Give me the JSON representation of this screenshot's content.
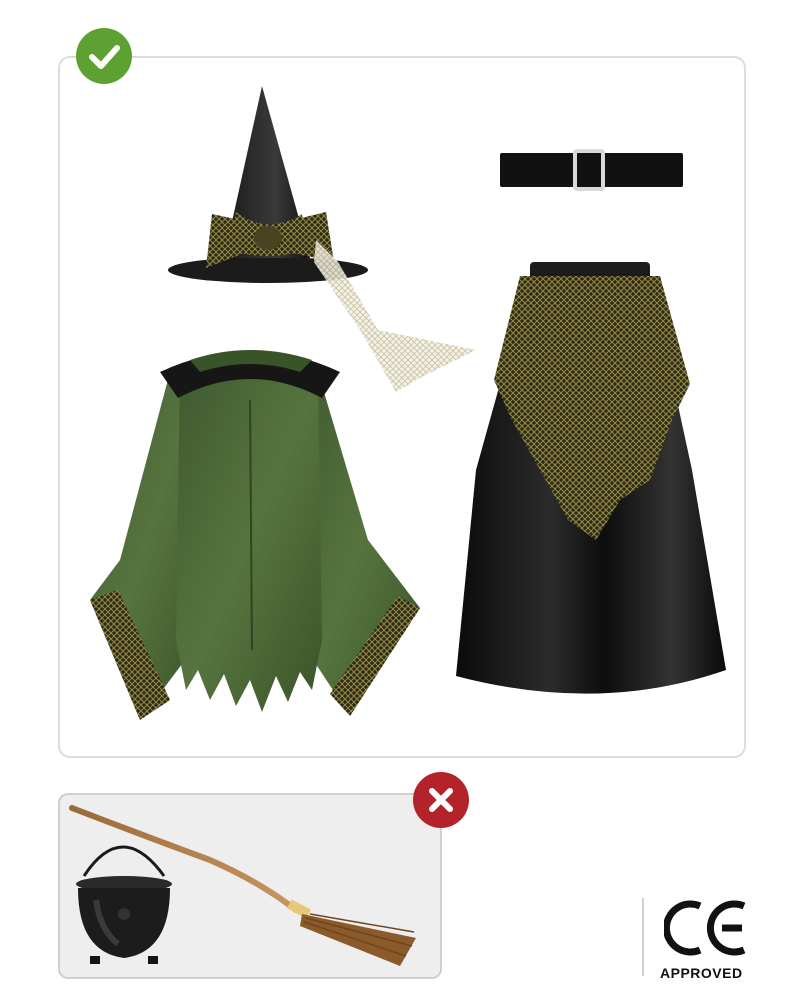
{
  "included": {
    "status": "included",
    "items": [
      "witch-hat",
      "belt",
      "green-jacket",
      "black-skirt"
    ]
  },
  "excluded": {
    "status": "not-included",
    "items": [
      "cauldron",
      "broom"
    ]
  },
  "certification": {
    "mark": "CE",
    "label": "APPROVED"
  },
  "colors": {
    "check_badge": "#5ca132",
    "cross_badge": "#b4232a",
    "jacket_green": "#4d6b3b",
    "fabric_black": "#141414",
    "gold_mesh": "#8a7a35"
  }
}
